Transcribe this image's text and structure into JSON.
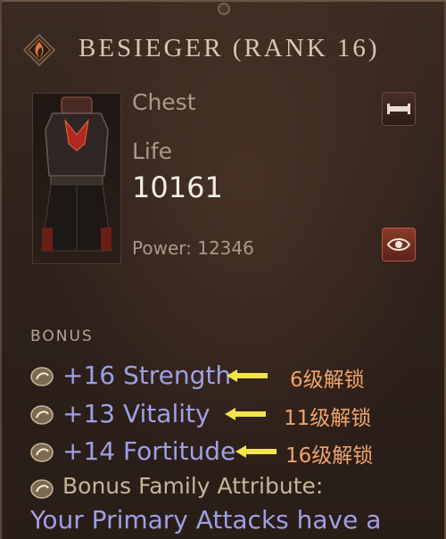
{
  "header": {
    "title": "BESIEGER (RANK 16)",
    "emblem_icon": "rank-emblem-icon"
  },
  "item": {
    "slot": "Chest",
    "stat_name": "Life",
    "stat_value": "10161",
    "power": "Power: 12346",
    "portrait_icon": "chest-armor-icon"
  },
  "buttons": {
    "compare_icon": "compare-icon",
    "view_icon": "eye-icon"
  },
  "bonus": {
    "heading": "BONUS",
    "rows": [
      {
        "text": "+16 Strength",
        "unlock": "6级解锁"
      },
      {
        "text": "+13 Vitality",
        "unlock": "11级解锁"
      },
      {
        "text": "+14 Fortitude",
        "unlock": "16级解锁"
      }
    ],
    "family_label": "Bonus Family Attribute:",
    "family_desc": "Your Primary Attacks have a"
  },
  "colors": {
    "bonus_text": "#9f9fe6",
    "unlock_text": "#f0a36a",
    "arrow": "#f2e44a",
    "title": "#d9c7b3"
  }
}
